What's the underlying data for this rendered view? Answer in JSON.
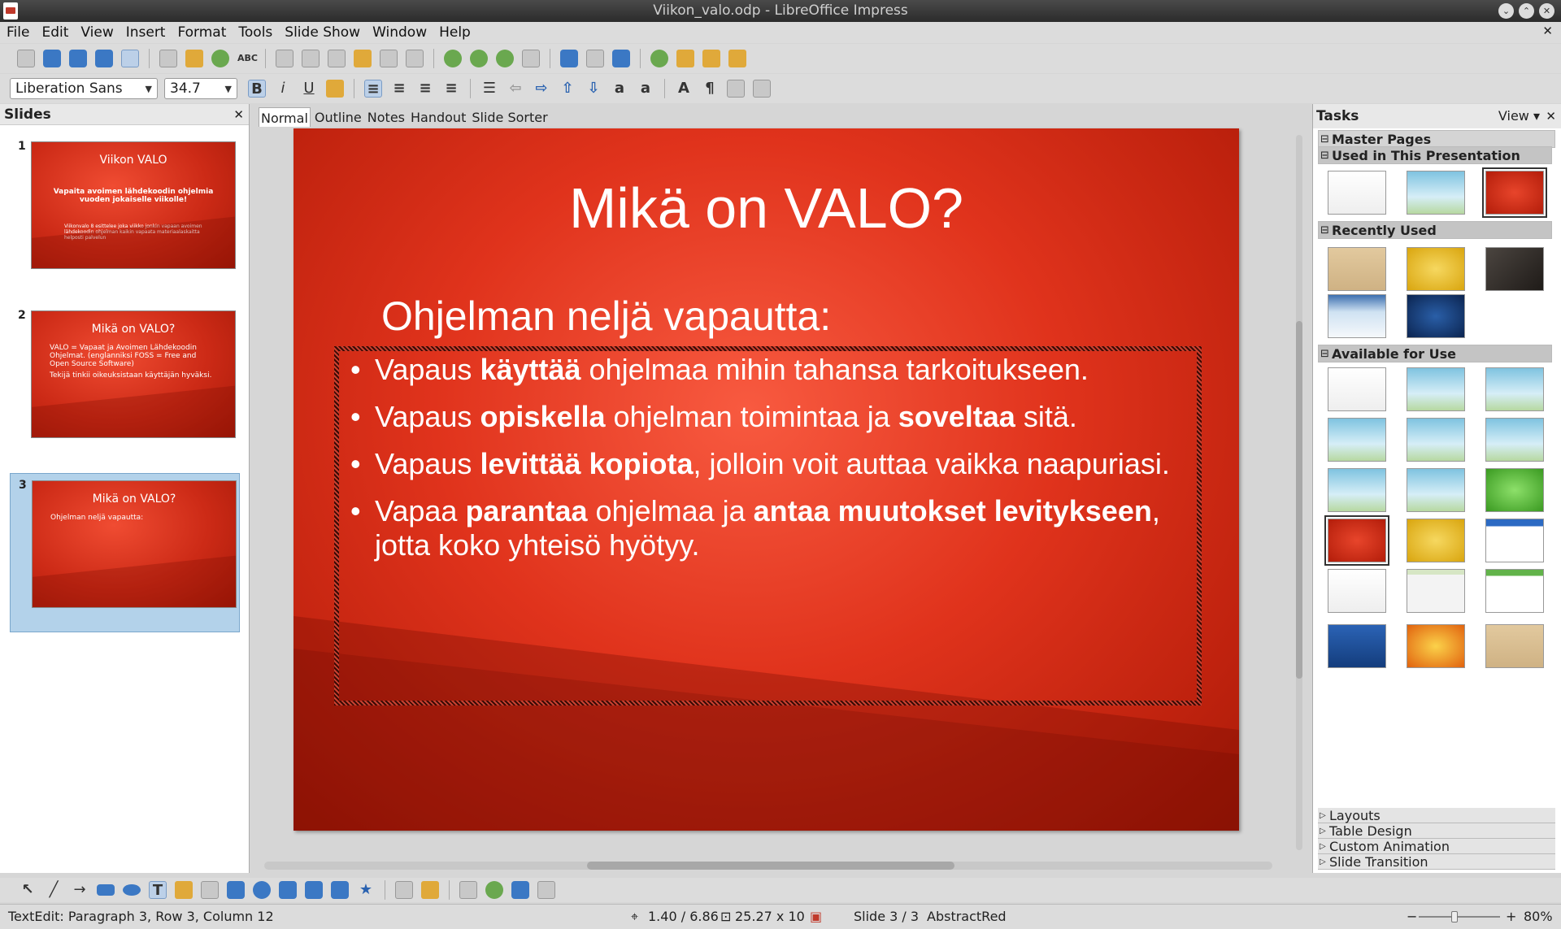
{
  "window": {
    "title": "Viikon_valo.odp - LibreOffice Impress"
  },
  "menu": [
    "File",
    "Edit",
    "View",
    "Insert",
    "Format",
    "Tools",
    "Slide Show",
    "Window",
    "Help"
  ],
  "format_toolbar": {
    "font": "Liberation Sans",
    "size": "34.7"
  },
  "slides_pane": {
    "header": "Slides",
    "slides": [
      {
        "num": "1",
        "title": "Viikon VALO",
        "subtitle": "Vapaita avoimen lähdekoodin ohjelmia vuoden jokaiselle viikolle!",
        "small": "Viikonvalo 8 esittelee joka viikko jonkin vapaan avoimen lähdekoodin ohjelman kaikin vapaata materiaalaskaitta helposti palvelun"
      },
      {
        "num": "2",
        "title": "Mikä on VALO?",
        "body": [
          "VALO = Vapaat ja Avoimen Lähdekoodin Ohjelmat. (englanniksi FOSS = Free and Open Source Software)",
          "Tekijä tinkii oikeuksistaan käyttäjän hyväksi."
        ]
      },
      {
        "num": "3",
        "title": "Mikä on VALO?",
        "body": [
          "Ohjelman neljä vapautta:"
        ]
      }
    ]
  },
  "view_tabs": [
    "Normal",
    "Outline",
    "Notes",
    "Handout",
    "Slide Sorter"
  ],
  "active_tab": "Normal",
  "slide": {
    "title": "Mikä on VALO?",
    "subtitle": "Ohjelman neljä vapautta:",
    "bullets": [
      [
        {
          "t": "Vapaus ",
          "b": false
        },
        {
          "t": "käyttää",
          "b": true
        },
        {
          "t": " ohjelmaa mihin tahansa tarkoitukseen.",
          "b": false
        }
      ],
      [
        {
          "t": "Vapaus ",
          "b": false
        },
        {
          "t": "opiskella",
          "b": true
        },
        {
          "t": " ohjelman toimintaa ja ",
          "b": false
        },
        {
          "t": "soveltaa",
          "b": true
        },
        {
          "t": " sitä.",
          "b": false
        }
      ],
      [
        {
          "t": "Vapaus ",
          "b": false
        },
        {
          "t": "levittää kopiota",
          "b": true
        },
        {
          "t": ", jolloin voit auttaa vaikka naapuriasi.",
          "b": false
        }
      ],
      [
        {
          "t": "Vapaa ",
          "b": false
        },
        {
          "t": "parantaa",
          "b": true
        },
        {
          "t": " ohjelmaa ja ",
          "b": false
        },
        {
          "t": "antaa muutokset levitykseen",
          "b": true
        },
        {
          "t": ", jotta koko yhteisö hyötyy.",
          "b": false
        }
      ]
    ]
  },
  "tasks": {
    "header": "Tasks",
    "view_label": "View",
    "master_pages": "Master Pages",
    "used": "Used in This Presentation",
    "recent": "Recently Used",
    "available": "Available for Use",
    "collapsed": [
      "Layouts",
      "Table Design",
      "Custom Animation",
      "Slide Transition"
    ]
  },
  "status": {
    "mode": "TextEdit: Paragraph 3, Row 3, Column 12",
    "position": "1.40 / 6.86",
    "size": "25.27 x 10",
    "slide": "Slide 3 / 3",
    "master": "AbstractRed",
    "zoom": "80%"
  },
  "colors": {
    "slide_red": "#d8301a",
    "selection": "#b3d2ea"
  }
}
